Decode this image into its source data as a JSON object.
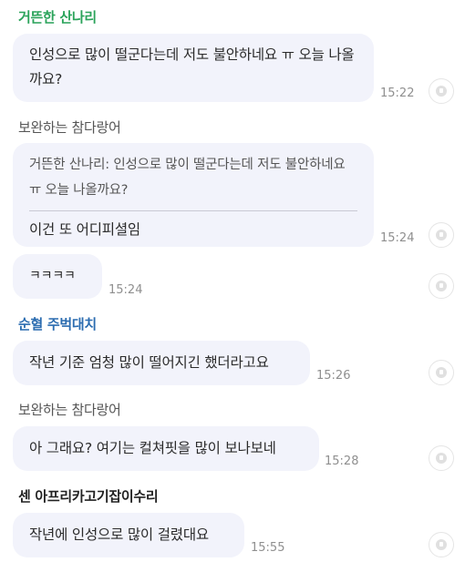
{
  "messages": [
    {
      "sender": "거뜬한 산나리",
      "sender_color": "#2aa35a",
      "text": "인성으로 많이 떨군다는데 저도 불안하네요 ㅠ 오늘 나올까요?",
      "time": "15:22"
    },
    {
      "sender": "보완하는 참다랑어",
      "sender_color": "#555555",
      "quote": "거뜬한 산나리: 인성으로 많이 떨군다는데 저도 불안하네요 ㅠ 오늘 나올까요?",
      "text": "이건 또 어디피셜임",
      "time": "15:24"
    },
    {
      "text": "ㅋㅋㅋㅋ",
      "time": "15:24"
    },
    {
      "sender": "순혈 주벅대치",
      "sender_color": "#2b6cb0",
      "text": "작년 기준 엄청 많이 떨어지긴 했더라고요",
      "time": "15:26"
    },
    {
      "sender": "보완하는 참다랑어",
      "sender_color": "#555555",
      "text": "아 그래요? 여기는 컬쳐핏을 많이 보나보네",
      "time": "15:28"
    },
    {
      "sender": "센 아프리카고기잡이수리",
      "sender_color": "#222222",
      "text": "작년에 인성으로 많이 걸렸대요",
      "time": "15:55"
    }
  ]
}
